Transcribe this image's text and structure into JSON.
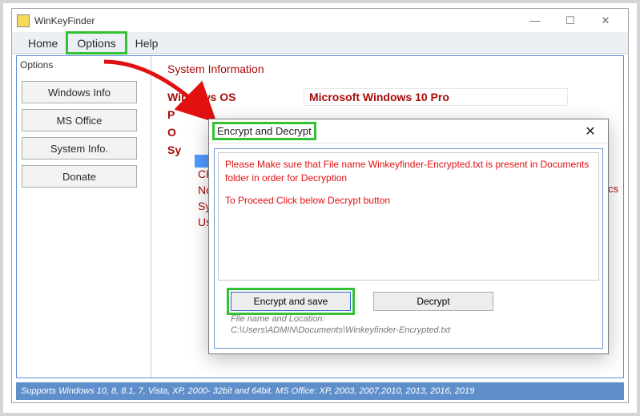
{
  "window": {
    "title": "WinKeyFinder",
    "menu": {
      "home": "Home",
      "options": "Options",
      "help": "Help"
    }
  },
  "sidebar": {
    "label": "Options",
    "items": [
      "Windows Info",
      "MS Office",
      "System Info.",
      "Donate"
    ]
  },
  "main": {
    "section_title": "System Information",
    "os_label": "Windows OS",
    "os_value": "Microsoft Windows 10 Pro",
    "row_pk": "P",
    "row_os2": "O",
    "row_sy": "Sy",
    "left_labels": [
      "CP",
      "No",
      "Sy",
      "Us"
    ],
    "right_edge": "nics"
  },
  "dialog": {
    "title": "Encrypt and Decrypt",
    "msg1": "Please Make sure that File name Winkeyfinder-Encrypted.txt is present in Documents folder in order for Decryption",
    "msg2": "To Proceed Click below Decrypt button",
    "btn_encrypt": "Encrypt and save",
    "btn_decrypt": "Decrypt",
    "path_label": "File name and Location:",
    "path_value": "C:\\Users\\ADMIN\\Documents\\Winkeyfinder-Encrypted.txt"
  },
  "footer": {
    "text": "Supports Windows 10, 8, 8.1, 7, Vista, XP, 2000- 32bit and 64bit. MS Office: XP, 2003, 2007,2010, 2013, 2016, 2019"
  }
}
